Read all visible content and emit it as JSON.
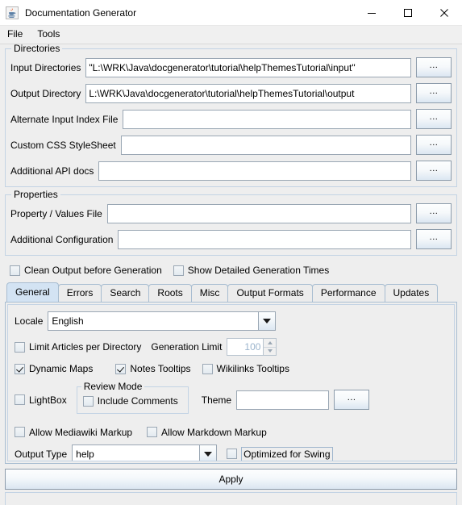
{
  "window": {
    "title": "Documentation Generator",
    "icon": "java-coffee-cup-icon",
    "minimize_label": "−",
    "maximize_label": "□",
    "close_label": "✕"
  },
  "menubar": {
    "items": [
      {
        "label": "File"
      },
      {
        "label": "Tools"
      }
    ]
  },
  "directories": {
    "group_title": "Directories",
    "browse_label": "...",
    "rows": [
      {
        "label": "Input Directories",
        "value": "\"L:\\WRK\\Java\\docgenerator\\tutorial\\helpThemesTutorial\\input\""
      },
      {
        "label": "Output Directory",
        "value": "L:\\WRK\\Java\\docgenerator\\tutorial\\helpThemesTutorial\\output"
      },
      {
        "label": "Alternate Input Index File",
        "value": ""
      },
      {
        "label": "Custom CSS StyleSheet",
        "value": ""
      },
      {
        "label": "Additional API docs",
        "value": ""
      }
    ]
  },
  "properties": {
    "group_title": "Properties",
    "browse_label": "...",
    "rows": [
      {
        "label": "Property / Values File",
        "value": ""
      },
      {
        "label": "Additional Configuration",
        "value": ""
      }
    ]
  },
  "global_options": [
    {
      "label": "Clean Output before Generation",
      "checked": false
    },
    {
      "label": "Show Detailed Generation Times",
      "checked": false
    }
  ],
  "tabs": [
    {
      "label": "General",
      "active": true
    },
    {
      "label": "Errors",
      "active": false
    },
    {
      "label": "Search",
      "active": false
    },
    {
      "label": "Roots",
      "active": false
    },
    {
      "label": "Misc",
      "active": false
    },
    {
      "label": "Output Formats",
      "active": false
    },
    {
      "label": "Performance",
      "active": false
    },
    {
      "label": "Updates",
      "active": false
    }
  ],
  "general_tab": {
    "locale_label": "Locale",
    "locale_value": "English",
    "limit_articles": {
      "label": "Limit Articles per Directory",
      "checked": false
    },
    "generation_limit_label": "Generation Limit",
    "generation_limit_value": "100",
    "dynamic_maps": {
      "label": "Dynamic Maps",
      "checked": true
    },
    "notes_tooltips": {
      "label": "Notes Tooltips",
      "checked": true
    },
    "wikilinks_tooltips": {
      "label": "Wikilinks Tooltips",
      "checked": false
    },
    "lightbox": {
      "label": "LightBox",
      "checked": false
    },
    "review_mode": {
      "title": "Review Mode",
      "include_comments": {
        "label": "Include Comments",
        "checked": false
      }
    },
    "theme_label": "Theme",
    "theme_value": "",
    "theme_browse_label": "...",
    "allow_mediawiki": {
      "label": "Allow Mediawiki Markup",
      "checked": false
    },
    "allow_markdown": {
      "label": "Allow Markdown Markup",
      "checked": false
    },
    "output_type_label": "Output Type",
    "output_type_value": "help",
    "optimized_for_swing": {
      "label": "Optimized for Swing",
      "checked": false
    }
  },
  "footer": {
    "apply_label": "Apply"
  },
  "colors": {
    "panel_bg": "#eeeeee",
    "tab_selected_bg": "#d3e3f3",
    "group_border": "#c3d3e4",
    "field_border": "#9aa7b4"
  }
}
